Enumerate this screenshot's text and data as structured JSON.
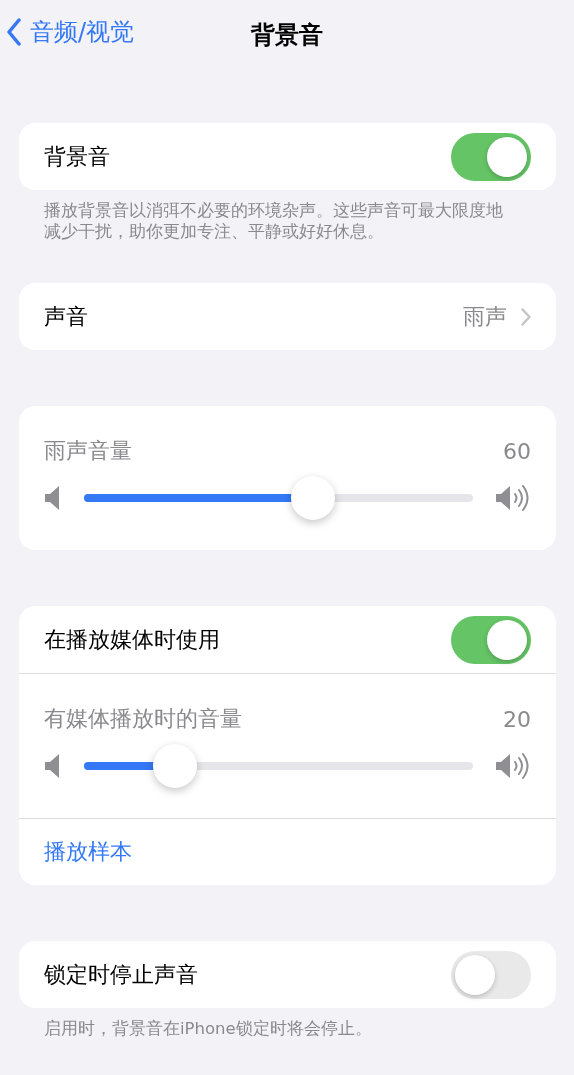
{
  "nav": {
    "back": "音频/视觉",
    "title": "背景音"
  },
  "sections": [
    {
      "rows": [
        {
          "kind": "toggle",
          "label": "背景音",
          "on": true
        }
      ],
      "footer": "播放背景音以消弭不必要的环境杂声。这些声音可最大限度地减少干扰，助你更加专注、平静或好好休息。"
    },
    {
      "rows": [
        {
          "kind": "link",
          "label": "声音",
          "value": "雨声"
        }
      ]
    },
    {
      "rows": [
        {
          "kind": "slider",
          "label": "雨声音量",
          "reading": "60",
          "level": 0.6
        }
      ]
    },
    {
      "rows": [
        {
          "kind": "toggle",
          "label": "在播放媒体时使用",
          "on": true
        },
        {
          "kind": "slider",
          "label": "有媒体播放时的音量",
          "reading": "20",
          "level": 0.2
        },
        {
          "kind": "action",
          "label": "播放样本"
        }
      ]
    },
    {
      "rows": [
        {
          "kind": "toggle",
          "label": "锁定时停止声音",
          "on": false
        }
      ],
      "footer": "启用时，背景音在iPhone锁定时将会停止。"
    }
  ]
}
